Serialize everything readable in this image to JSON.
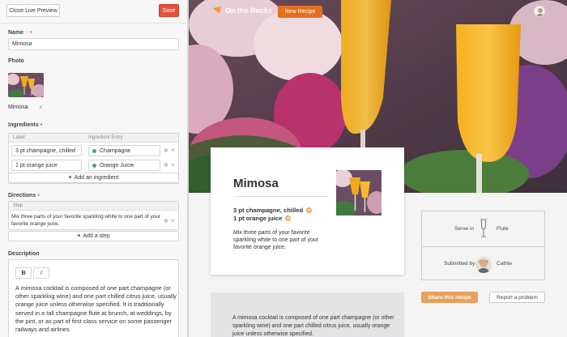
{
  "editor": {
    "close_label": "Close Live Preview",
    "save_label": "Save",
    "name_label": "Name",
    "name_value": "Mimosa",
    "photo_label": "Photo",
    "photo_filename": "Mimosa",
    "ingredients_label": "Ingredients",
    "ingredients_columns": [
      "Label",
      "Ingredient Entry"
    ],
    "ingredients": [
      {
        "label": "3 pt champagne, chilled",
        "entry": "Champagne"
      },
      {
        "label": "1 pt orange juice",
        "entry": "Orange Juice"
      }
    ],
    "add_ingredient_label": "Add an ingredient",
    "directions_label": "Directions",
    "directions_column": "Step",
    "directions_step": "Mix three parts of your favorite sparkling white to one part of your favorite orange juice.",
    "add_step_label": "Add a step",
    "description_label": "Description",
    "bold_label": "B",
    "italic_label": "I",
    "description_text": "A mimosa cocktail is composed of one part champagne (or other sparkling wine) and one part chilled citrus juice, usually orange juice unless otherwise specified. It is traditionally served in a tall champagne flute at brunch, at weddings, by the pint, or as part of first class service on some passenger railways and airlines."
  },
  "preview": {
    "brand": "On the Rocks",
    "new_recipe_label": "New Recipe",
    "recipe_title": "Mimosa",
    "ingredients": [
      "3 pt champagne, chilled",
      "1 pt orange juice"
    ],
    "directions": "Mix three parts of your favorite sparkling white to one part of your favorite orange juice.",
    "serve_in_label": "Serve in",
    "glass": "Flute",
    "submitted_by_label": "Submitted by",
    "submitter": "Cathie",
    "share_label": "Share this recipe",
    "report_label": "Report a problem",
    "description": "A mimosa cocktail is composed of one part champagne (or other sparkling wine) and one part chilled citrus juice, usually orange juice unless otherwise specified."
  },
  "colors": {
    "save": "#e0533d",
    "new_recipe": "#e56f1e",
    "share": "#e9a05a",
    "ingredient_dot": "#3cae5c"
  },
  "icons": [
    "eye-icon",
    "remove-icon",
    "drag-handle-icon",
    "plus-icon",
    "logo-icon",
    "flute-glass-icon",
    "swap-icon"
  ]
}
